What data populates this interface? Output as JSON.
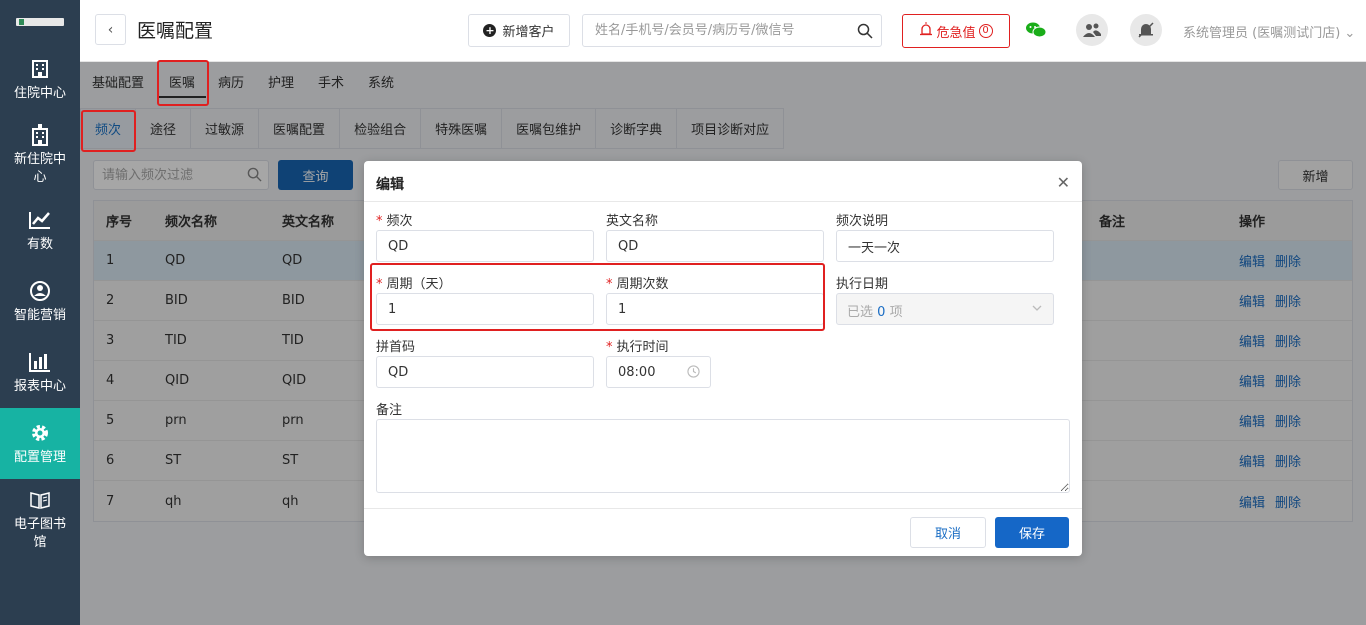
{
  "sidebar": {
    "items": [
      {
        "label": "住院中心",
        "icon": "building-icon"
      },
      {
        "label": "新住院中心",
        "icon": "hospital-icon"
      },
      {
        "label": "有数",
        "icon": "trend-chart-icon"
      },
      {
        "label": "智能营销",
        "icon": "marketing-icon"
      },
      {
        "label": "报表中心",
        "icon": "bar-chart-icon"
      },
      {
        "label": "配置管理",
        "icon": "gear-icon"
      },
      {
        "label": "电子图书馆",
        "icon": "book-icon"
      }
    ]
  },
  "header": {
    "title": "医嘱配置",
    "add_customer": "新增客户",
    "search_placeholder": "姓名/手机号/会员号/病历号/微信号",
    "critical_label": "危急值",
    "critical_count": "0",
    "user": "系统管理员 (医嘱测试门店)"
  },
  "top_tabs": [
    "基础配置",
    "医嘱",
    "病历",
    "护理",
    "手术",
    "系统"
  ],
  "sub_tabs": [
    "频次",
    "途径",
    "过敏源",
    "医嘱配置",
    "检验组合",
    "特殊医嘱",
    "医嘱包维护",
    "诊断字典",
    "项目诊断对应"
  ],
  "filter": {
    "placeholder": "请输入频次过滤",
    "query": "查询",
    "add": "新增"
  },
  "table": {
    "headers": [
      "序号",
      "频次名称",
      "英文名称",
      "备注",
      "操作"
    ],
    "edit": "编辑",
    "delete": "删除",
    "rows": [
      {
        "no": "1",
        "name": "QD",
        "en": "QD"
      },
      {
        "no": "2",
        "name": "BID",
        "en": "BID"
      },
      {
        "no": "3",
        "name": "TID",
        "en": "TID"
      },
      {
        "no": "4",
        "name": "QID",
        "en": "QID"
      },
      {
        "no": "5",
        "name": "prn",
        "en": "prn"
      },
      {
        "no": "6",
        "name": "ST",
        "en": "ST"
      },
      {
        "no": "7",
        "name": "qh",
        "en": "qh"
      }
    ]
  },
  "dialog": {
    "title": "编辑",
    "fields": {
      "freq_label": "频次",
      "freq_value": "QD",
      "en_label": "英文名称",
      "en_value": "QD",
      "desc_label": "频次说明",
      "desc_value": "一天一次",
      "cycle_label": "周期（天）",
      "cycle_value": "1",
      "cycle_count_label": "周期次数",
      "cycle_count_value": "1",
      "exec_date_label": "执行日期",
      "exec_date_prefix": "已选",
      "exec_date_count": "0",
      "exec_date_suffix": "项",
      "pinyin_label": "拼首码",
      "pinyin_value": "QD",
      "exec_time_label": "执行时间",
      "exec_time_value": "08:00",
      "remark_label": "备注"
    },
    "cancel": "取消",
    "save": "保存"
  }
}
